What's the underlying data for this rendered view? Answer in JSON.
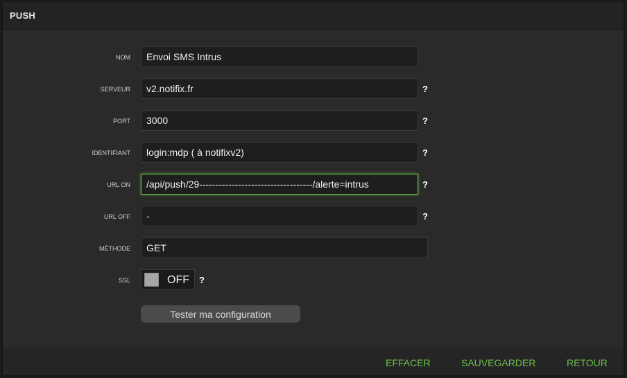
{
  "panel": {
    "title": "PUSH"
  },
  "form": {
    "nom": {
      "label": "NOM",
      "value": "Envoi SMS Intrus"
    },
    "serveur": {
      "label": "SERVEUR",
      "value": "v2.notifix.fr"
    },
    "port": {
      "label": "PORT",
      "value": "3000"
    },
    "identifiant": {
      "label": "IDENTIFIANT",
      "value": "login:mdp ( à notifixv2)"
    },
    "url_on": {
      "label": "URL ON",
      "value": "/api/push/29-----------------------------------/alerte=intrus"
    },
    "url_off": {
      "label": "URL OFF",
      "value": "-"
    },
    "methode": {
      "label": "MÉTHODE",
      "value": "GET"
    },
    "ssl": {
      "label": "SSL",
      "state": "OFF"
    },
    "help": "?"
  },
  "buttons": {
    "test": "Tester ma configuration",
    "effacer": "EFFACER",
    "sauvegarder": "SAUVEGARDER",
    "retour": "RETOUR"
  },
  "colors": {
    "accent": "#6cc24a",
    "focus": "#6ec84a"
  }
}
